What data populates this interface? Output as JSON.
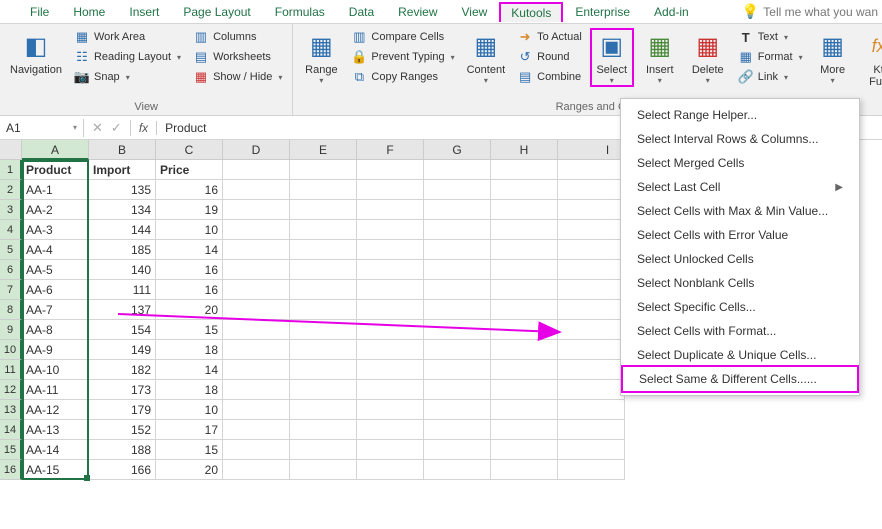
{
  "ribbon": {
    "tabs": [
      "File",
      "Home",
      "Insert",
      "Page Layout",
      "Formulas",
      "Data",
      "Review",
      "View",
      "Kutools",
      "Enterprise",
      "Add-in"
    ],
    "active_tab": "Kutools",
    "tell_me": "Tell me what you wan"
  },
  "groups": {
    "view": {
      "label": "View",
      "navigation": "Navigation",
      "work_area": "Work Area",
      "reading_layout": "Reading Layout",
      "snap": "Snap",
      "columns": "Columns",
      "worksheets": "Worksheets",
      "show_hide": "Show / Hide"
    },
    "ranges": {
      "label": "Ranges and Cells",
      "range": "Range",
      "compare": "Compare Cells",
      "prevent": "Prevent Typing",
      "copy": "Copy Ranges",
      "content": "Content",
      "to_actual": "To Actual",
      "round": "Round",
      "combine": "Combine",
      "select": "Select",
      "insert": "Insert",
      "delete": "Delete",
      "text": "Text",
      "format": "Format",
      "link": "Link",
      "more": "More",
      "kt": "Kt\nFun"
    }
  },
  "formula_bar": {
    "cell_ref": "A1",
    "value": "Product"
  },
  "columns": [
    "A",
    "B",
    "C",
    "D",
    "E",
    "F",
    "G",
    "H",
    "I"
  ],
  "sheet": {
    "headers": [
      "Product",
      "Import",
      "Price"
    ],
    "rows": [
      {
        "p": "AA-1",
        "i": 135,
        "pr": 16
      },
      {
        "p": "AA-2",
        "i": 134,
        "pr": 19
      },
      {
        "p": "AA-3",
        "i": 144,
        "pr": 10
      },
      {
        "p": "AA-4",
        "i": 185,
        "pr": 14
      },
      {
        "p": "AA-5",
        "i": 140,
        "pr": 16
      },
      {
        "p": "AA-6",
        "i": 111,
        "pr": 16
      },
      {
        "p": "AA-7",
        "i": 137,
        "pr": 20
      },
      {
        "p": "AA-8",
        "i": 154,
        "pr": 15
      },
      {
        "p": "AA-9",
        "i": 149,
        "pr": 18
      },
      {
        "p": "AA-10",
        "i": 182,
        "pr": 14
      },
      {
        "p": "AA-11",
        "i": 173,
        "pr": 18
      },
      {
        "p": "AA-12",
        "i": 179,
        "pr": 10
      },
      {
        "p": "AA-13",
        "i": 152,
        "pr": 17
      },
      {
        "p": "AA-14",
        "i": 188,
        "pr": 15
      },
      {
        "p": "AA-15",
        "i": 166,
        "pr": 20
      }
    ]
  },
  "menu": {
    "items": [
      "Select Range Helper...",
      "Select Interval Rows & Columns...",
      "Select Merged Cells",
      "Select Last Cell",
      "Select Cells with Max & Min Value...",
      "Select Cells with Error Value",
      "Select Unlocked Cells",
      "Select Nonblank Cells",
      "Select Specific Cells...",
      "Select Cells with Format...",
      "Select Duplicate & Unique Cells...",
      "Select Same & Different Cells......"
    ],
    "submenu_index": 3,
    "highlight_index": 11
  }
}
